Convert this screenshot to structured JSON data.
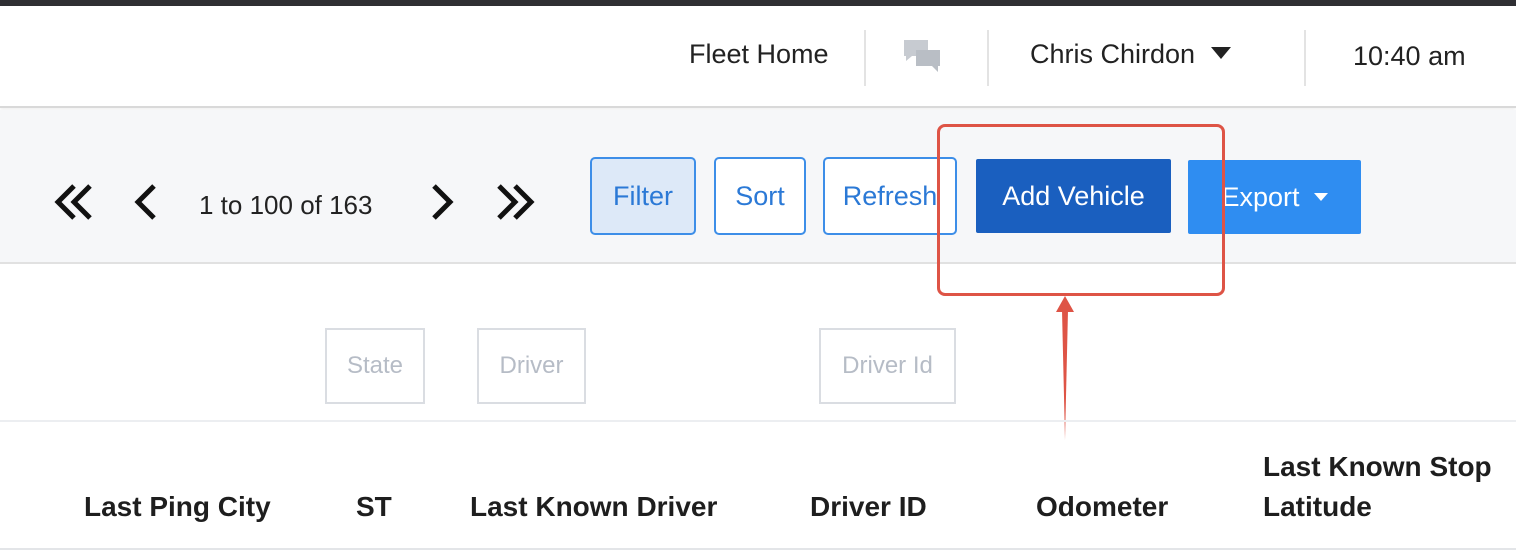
{
  "header": {
    "fleet_home": "Fleet Home",
    "chat_icon": "chat-bubbles-icon",
    "user_name": "Chris Chirdon",
    "time": "10:40 am"
  },
  "pagination": {
    "first_icon": "double-chevron-left-icon",
    "prev_icon": "chevron-left-icon",
    "range_text": "1 to 100 of 163",
    "next_icon": "chevron-right-icon",
    "last_icon": "double-chevron-right-icon"
  },
  "toolbar": {
    "filter_label": "Filter",
    "sort_label": "Sort",
    "refresh_label": "Refresh",
    "add_vehicle_label": "Add Vehicle",
    "export_label": "Export"
  },
  "filters": {
    "state_placeholder": "State",
    "driver_placeholder": "Driver",
    "driver_id_placeholder": "Driver Id"
  },
  "table": {
    "columns": [
      "Last Ping City",
      "ST",
      "Last Known Driver",
      "Driver ID",
      "Odometer",
      "Last Known Stop",
      "Latitude"
    ]
  },
  "colors": {
    "primary": "#1a5fbf",
    "secondary": "#2f8df1",
    "outline": "#3d8ee8",
    "annotation": "#de5446"
  }
}
